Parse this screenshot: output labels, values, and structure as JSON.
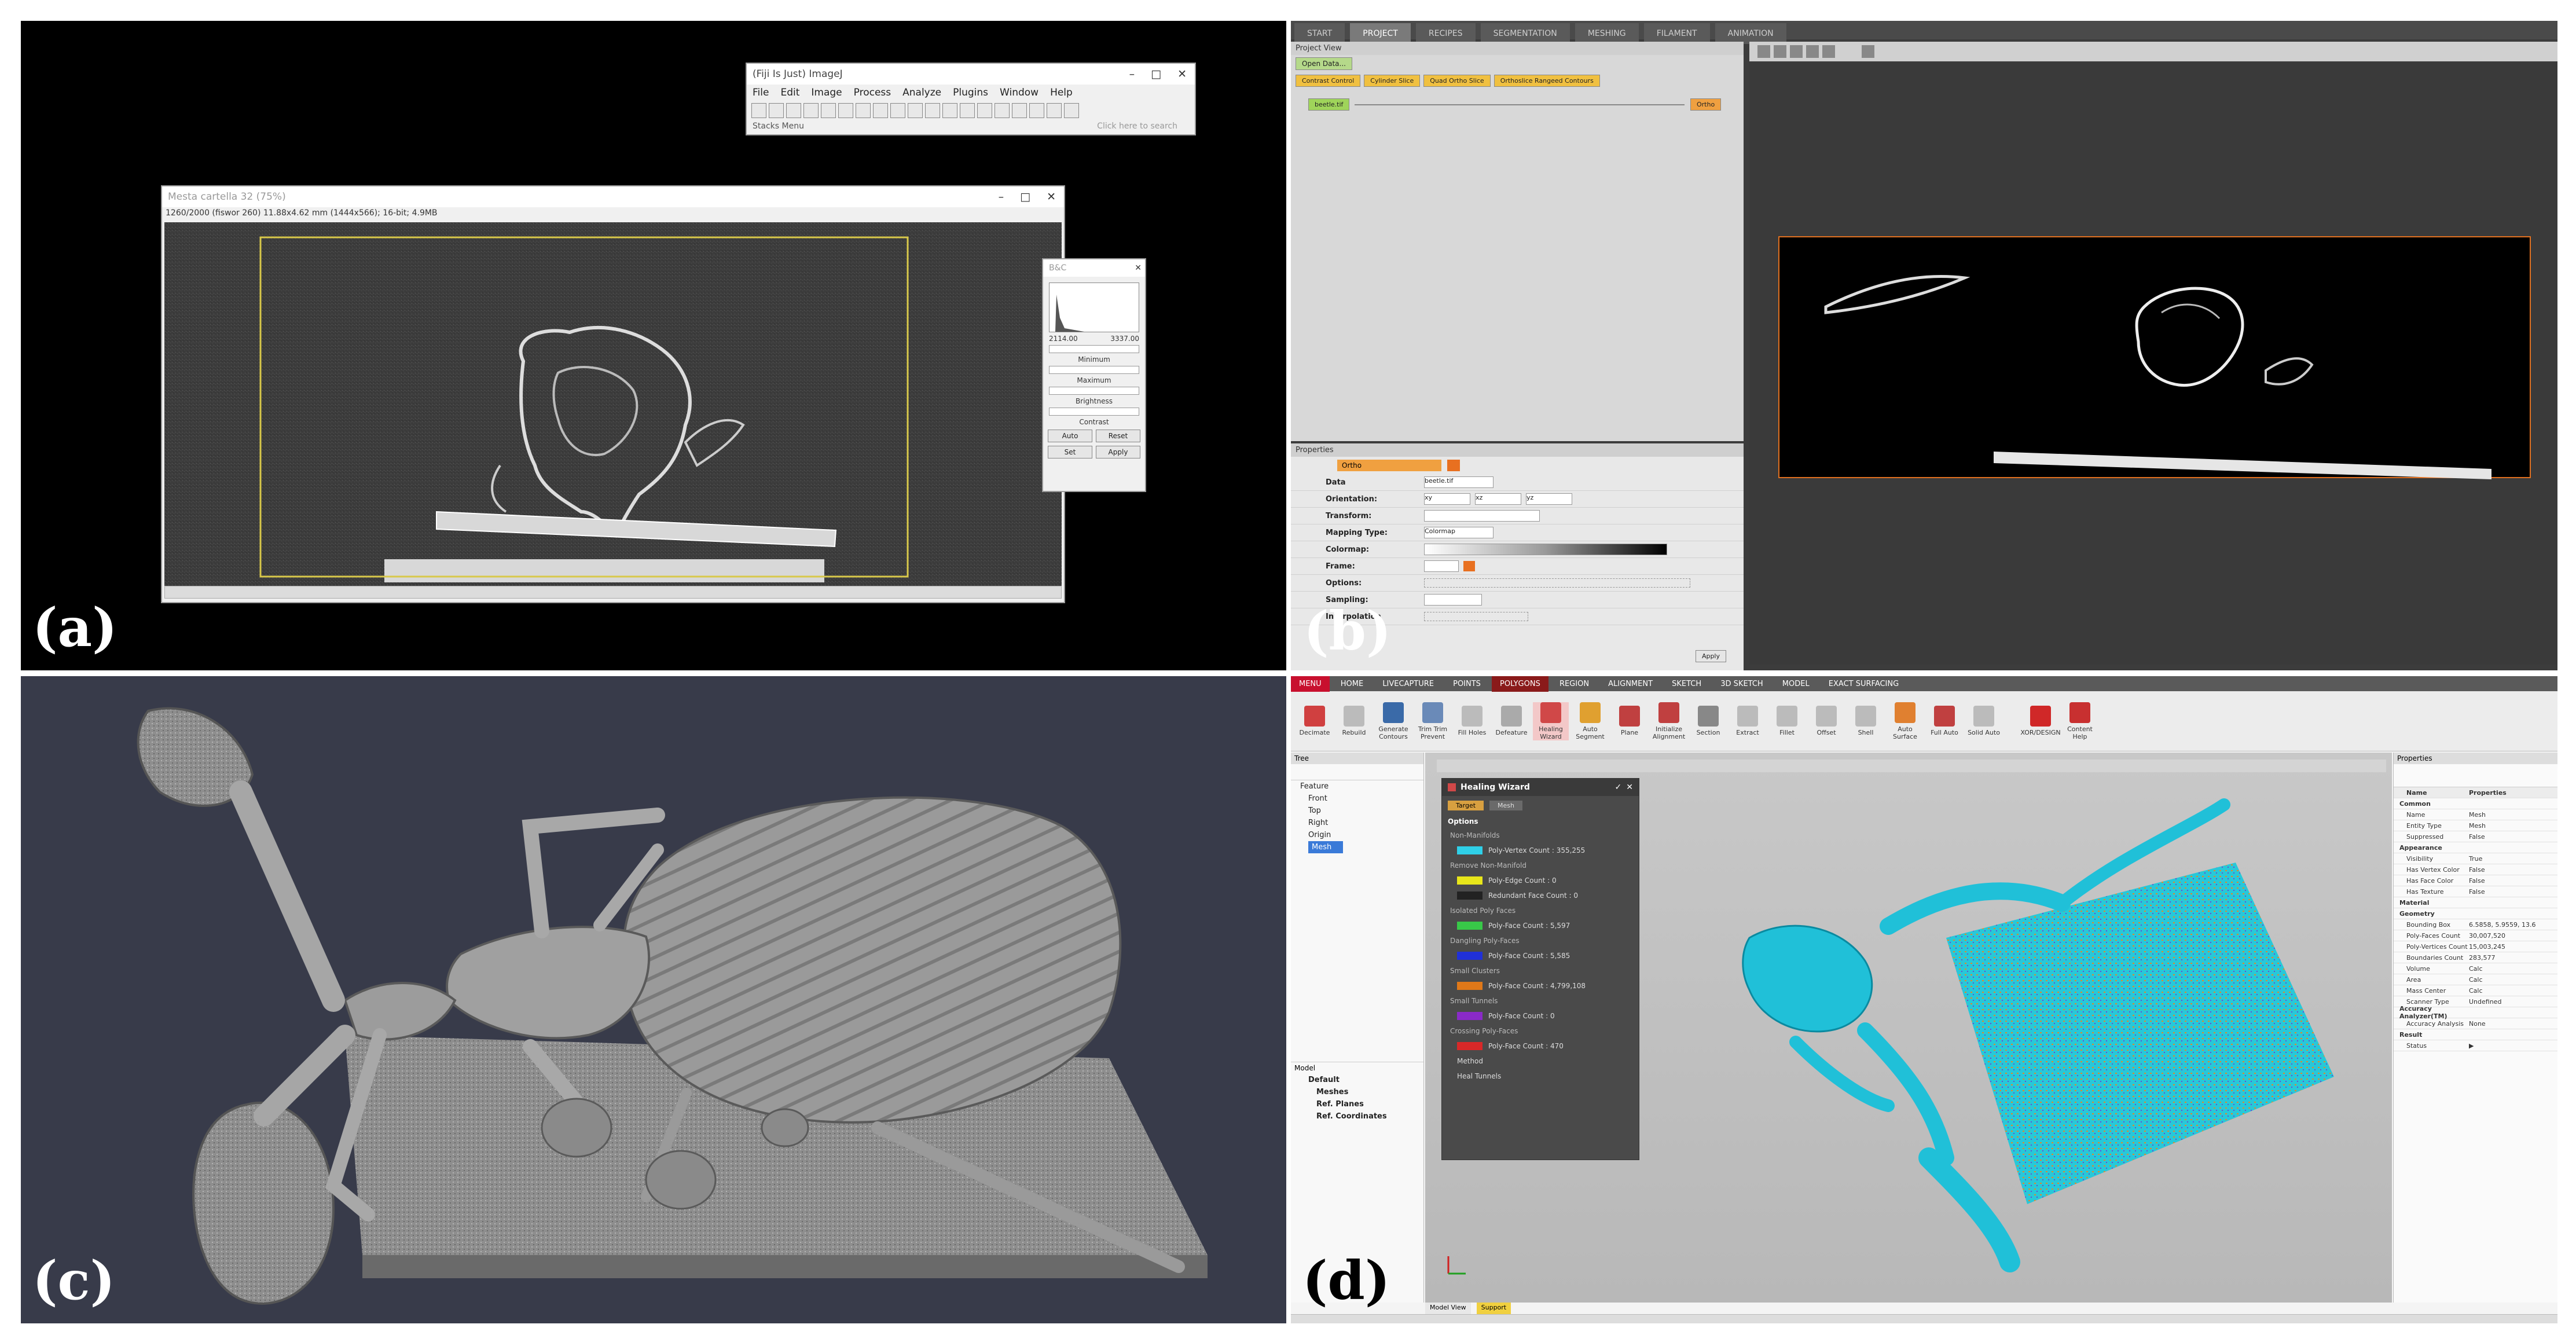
{
  "labels": {
    "a": "(a)",
    "b": "(b)",
    "c": "(c)",
    "d": "(d)"
  },
  "panel_a": {
    "imagej_title": "(Fiji Is Just) ImageJ",
    "menu": [
      "File",
      "Edit",
      "Image",
      "Process",
      "Analyze",
      "Plugins",
      "Window",
      "Help"
    ],
    "status_left": "Stacks Menu",
    "status_right": "Click here to search",
    "stack_title": "Mesta cartella 32 (75%)",
    "stack_info": "1260/2000 (fiswor 260) 11.88x4.62 mm (1444x566); 16-bit; 4.9MB",
    "bc_title": "B&C",
    "bc_min": "2114.00",
    "bc_max": "3337.00",
    "bc_labels": [
      "Minimum",
      "Maximum",
      "Brightness",
      "Contrast"
    ],
    "bc_buttons": [
      "Auto",
      "Reset",
      "Set",
      "Apply"
    ]
  },
  "panel_b": {
    "tabs": [
      "START",
      "PROJECT",
      "RECIPES",
      "SEGMENTATION",
      "MESHING",
      "FILAMENT",
      "ANIMATION"
    ],
    "project_view": "Project View",
    "open_data": "Open Data...",
    "quick_buttons": [
      "Contrast Control",
      "Cylinder Slice",
      "Quad Ortho Slice",
      "Orthoslice Rangeed Contours"
    ],
    "node_left": "beetle.tif",
    "node_right": "Ortho",
    "properties": "Properties",
    "props_header": "Ortho",
    "prop_rows": [
      "Data",
      "Orientation:",
      "Transform:",
      "Mapping Type:",
      "Colormap:",
      "Frame:",
      "Options:",
      "Sampling:",
      "Interpolation"
    ],
    "data_value": "beetle.tif",
    "orient_values": [
      "xy",
      "xz",
      "yz"
    ],
    "mapping_value": "Colormap",
    "apply": "Apply"
  },
  "panel_c": {},
  "panel_d": {
    "ribbon_tabs": [
      "MENU",
      "HOME",
      "LIVECAPTURE",
      "POINTS",
      "POLYGONS",
      "REGION",
      "ALIGNMENT",
      "SKETCH",
      "3D SKETCH",
      "MODEL",
      "EXACT SURFACING"
    ],
    "ribbon_buttons": [
      "Decimate",
      "Rebuild",
      "Generate Contours",
      "Trim Trim Prevent",
      "Fill Holes",
      "Defeature",
      "Healing Wizard",
      "Auto Segment",
      "Plane",
      "Initialize Alignment",
      "Section",
      "Extract",
      "Fillet",
      "Offset",
      "Shell",
      "Auto Surface",
      "Full Auto",
      "Solid Auto",
      "XOR/DESIGN",
      "Content Help"
    ],
    "tree_title": "Tree",
    "tree_items": [
      "Feature",
      "Front",
      "Top",
      "Right",
      "Origin",
      "Mesh"
    ],
    "model_title": "Model",
    "model_items": [
      "Default",
      "Meshes",
      "Ref. Planes",
      "Ref. Coordinates"
    ],
    "hw_title": "Healing Wizard",
    "hw_tabs": [
      "Target",
      "Mesh"
    ],
    "hw_options": "Options",
    "hw_rows": [
      {
        "label": "Non-Manifolds",
        "value": "Poly-Vertex Count : 355,255",
        "color": "#2fd0e8"
      },
      {
        "label": "Remove Non-Manifold",
        "value": "",
        "color": ""
      },
      {
        "label": "",
        "value": "Poly-Edge Count : 0",
        "color": "#e8e61a"
      },
      {
        "label": "",
        "value": "Redundant Face Count : 0",
        "color": "#222222"
      },
      {
        "label": "Isolated Poly Faces",
        "value": "Poly-Face Count : 5,597",
        "color": "#38c848"
      },
      {
        "label": "Dangling Poly-Faces",
        "value": "Poly-Face Count : 5,585",
        "color": "#2030d8"
      },
      {
        "label": "Small Clusters",
        "value": "Poly-Face Count : 4,799,108",
        "color": "#e07818"
      },
      {
        "label": "Small Tunnels",
        "value": "Poly-Face Count : 0",
        "color": "#8a2ac8"
      },
      {
        "label": "Crossing Poly-Faces",
        "value": "Poly-Face Count : 470",
        "color": "#d82828"
      }
    ],
    "hw_footer": [
      "Method",
      "Heal Tunnels"
    ],
    "props_title": "Properties",
    "props_header": [
      "Name",
      "Properties"
    ],
    "props_rows": [
      [
        "Common",
        ""
      ],
      [
        "Name",
        "Mesh"
      ],
      [
        "Entity Type",
        "Mesh"
      ],
      [
        "Suppressed",
        "False"
      ],
      [
        "Appearance",
        ""
      ],
      [
        "Visibility",
        "True"
      ],
      [
        "Has Vertex Color",
        "False"
      ],
      [
        "Has Face Color",
        "False"
      ],
      [
        "Has Texture",
        "False"
      ],
      [
        "Material",
        ""
      ],
      [
        "Geometry",
        ""
      ],
      [
        "Bounding Box",
        "6.5858, 5.9559, 13.6"
      ],
      [
        "Poly-Faces Count",
        "30,007,520"
      ],
      [
        "Poly-Vertices Count",
        "15,003,245"
      ],
      [
        "Boundaries Count",
        "283,577"
      ],
      [
        "Volume",
        "Calc"
      ],
      [
        "Area",
        "Calc"
      ],
      [
        "Mass Center",
        "Calc"
      ],
      [
        "Scanner Type",
        "Undefined"
      ],
      [
        "Accuracy Analyzer(TM)",
        ""
      ],
      [
        "Accuracy Analysis",
        "None"
      ],
      [
        "Result",
        ""
      ],
      [
        "Status",
        "▶"
      ]
    ],
    "bottom_tabs": [
      "Model View",
      "Support"
    ]
  }
}
